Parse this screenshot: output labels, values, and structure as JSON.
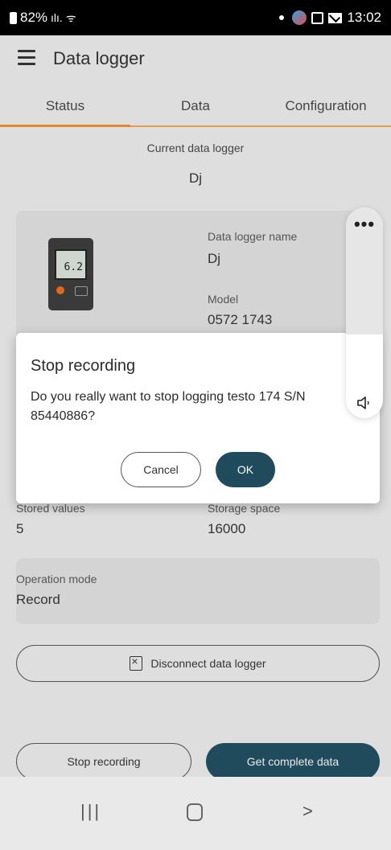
{
  "status_bar": {
    "battery": "82%",
    "time": "13:02"
  },
  "app_bar": {
    "title": "Data logger"
  },
  "tabs": [
    {
      "label": "Status",
      "active": true
    },
    {
      "label": "Data",
      "active": false
    },
    {
      "label": "Configuration",
      "active": false
    }
  ],
  "current_logger": {
    "label": "Current data logger",
    "value": "Dj"
  },
  "logger_card": {
    "device_display": "6.2",
    "name_label": "Data logger name",
    "name_value": "Dj",
    "model_label": "Model",
    "model_value": "0572 1743"
  },
  "storage": {
    "stored_values_label": "Stored values",
    "stored_values": "5",
    "storage_space_label": "Storage space",
    "storage_space": "16000"
  },
  "operation": {
    "label": "Operation mode",
    "value": "Record"
  },
  "buttons": {
    "disconnect": "Disconnect data logger",
    "stop_recording": "Stop recording",
    "get_complete_data": "Get complete data"
  },
  "dialog": {
    "title": "Stop recording",
    "message": "Do you really want to stop logging testo 174 S/N 85440886?",
    "cancel": "Cancel",
    "ok": "OK"
  },
  "volume": {
    "more": "•••",
    "level": 0.4
  },
  "nav_bar": {
    "recents": "|||",
    "back": ">"
  },
  "colors": {
    "accent": "#e3892c",
    "primary_button": "#1f4b5c"
  }
}
